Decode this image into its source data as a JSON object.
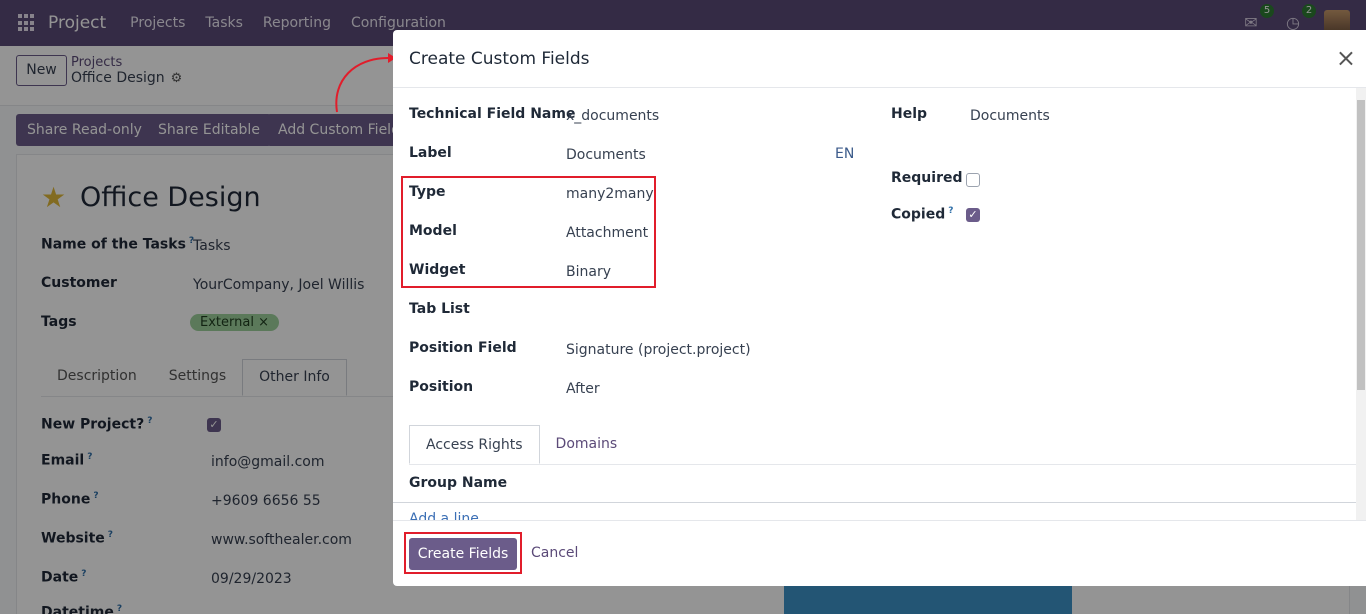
{
  "navbar": {
    "app_name": "Project",
    "menu": [
      "Projects",
      "Tasks",
      "Reporting",
      "Configuration"
    ],
    "messages_count": "5",
    "activities_count": "2"
  },
  "control": {
    "new_label": "New",
    "breadcrumb_parent": "Projects",
    "breadcrumb_current": "Office Design"
  },
  "actions": [
    "Share Read-only",
    "Share Editable",
    "Add Custom Field"
  ],
  "form": {
    "title": "Office Design",
    "fields": [
      {
        "label": "Name of the Tasks",
        "help": "?",
        "value": "Tasks"
      },
      {
        "label": "Customer",
        "value": "YourCompany, Joel Willis"
      },
      {
        "label": "Tags",
        "value": "External ×"
      }
    ],
    "tabs": [
      "Description",
      "Settings",
      "Other Info"
    ],
    "other_info": [
      {
        "label": "New Project?",
        "help": "?",
        "value": "checked"
      },
      {
        "label": "Email",
        "help": "?",
        "value": "info@gmail.com"
      },
      {
        "label": "Phone",
        "help": "?",
        "value": "+9609 6656 55"
      },
      {
        "label": "Website",
        "help": "?",
        "value": "www.softhealer.com"
      },
      {
        "label": "Date",
        "help": "?",
        "value": "09/29/2023"
      },
      {
        "label": "Datetime",
        "help": "?",
        "value": ""
      }
    ]
  },
  "dialog": {
    "title": "Create Custom Fields",
    "close_label": "×",
    "fields": {
      "technical_name": {
        "label": "Technical Field Name",
        "value": "x_documents"
      },
      "label": {
        "label": "Label",
        "value": "Documents",
        "lang": "EN"
      },
      "type": {
        "label": "Type",
        "value": "many2many"
      },
      "model": {
        "label": "Model",
        "value": "Attachment"
      },
      "widget": {
        "label": "Widget",
        "value": "Binary"
      },
      "tab_list": {
        "label": "Tab List",
        "value": ""
      },
      "position_field": {
        "label": "Position Field",
        "value": "Signature (project.project)"
      },
      "position": {
        "label": "Position",
        "value": "After"
      },
      "help": {
        "label": "Help",
        "value": "Documents"
      },
      "required": {
        "label": "Required",
        "checked": false
      },
      "copied": {
        "label": "Copied",
        "help": "?",
        "checked": true
      }
    },
    "tabs": [
      "Access Rights",
      "Domains"
    ],
    "grid_header": "Group Name",
    "add_line": "Add a line",
    "create_label": "Create Fields",
    "cancel_label": "Cancel"
  },
  "colors": {
    "brand": "#5b4a78",
    "primary_button": "#6b5c8a",
    "highlight": "#e11d2b"
  }
}
